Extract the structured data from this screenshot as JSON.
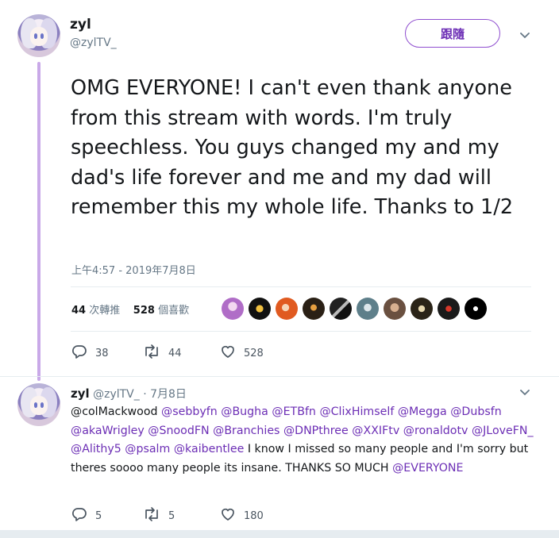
{
  "main_tweet": {
    "author_name": "zyl",
    "author_handle": "@zylTV_",
    "follow_label": "跟隨",
    "text": "OMG EVERYONE! I can't even thank anyone from this stream with words. I'm truly speechless. You guys changed my and my dad's life forever and me and my dad will remember this my whole life. Thanks to 1/2",
    "timestamp": "上午4:57 - 2019年7月8日",
    "retweets_count": "44",
    "retweets_label": "次轉推",
    "likes_count": "528",
    "likes_label": "個喜歡",
    "actions": {
      "replies": "38",
      "retweets": "44",
      "likes": "528"
    }
  },
  "reply_tweet": {
    "author_name": "zyl",
    "author_handle": "@zylTV_",
    "date": "· 7月8日",
    "mention_first": "@colMackwood",
    "mentions": [
      "@sebbyfn",
      "@Bugha",
      "@ETBfn",
      "@ClixHimself",
      "@Megga",
      "@Dubsfn",
      "@akaWrigley",
      "@SnoodFN",
      "@Branchies",
      "@DNPthree",
      "@XXIFtv",
      "@ronaldotv",
      "@JLoveFN_",
      "@Alithy5",
      "@psalm",
      "@kaibentlee"
    ],
    "text_after": "I know I missed so many people and I'm sorry but theres soooo many people its insane. THANKS SO MUCH",
    "mention_last": "@EVERYONE",
    "actions": {
      "replies": "5",
      "retweets": "5",
      "likes": "180"
    }
  },
  "icons": {
    "reply": "reply-icon",
    "retweet": "retweet-icon",
    "like": "heart-icon",
    "menu": "chevron-down-icon"
  },
  "colors": {
    "accent": "#6c2eb5",
    "thread_line": "#c9a9e8",
    "muted": "#657786"
  }
}
